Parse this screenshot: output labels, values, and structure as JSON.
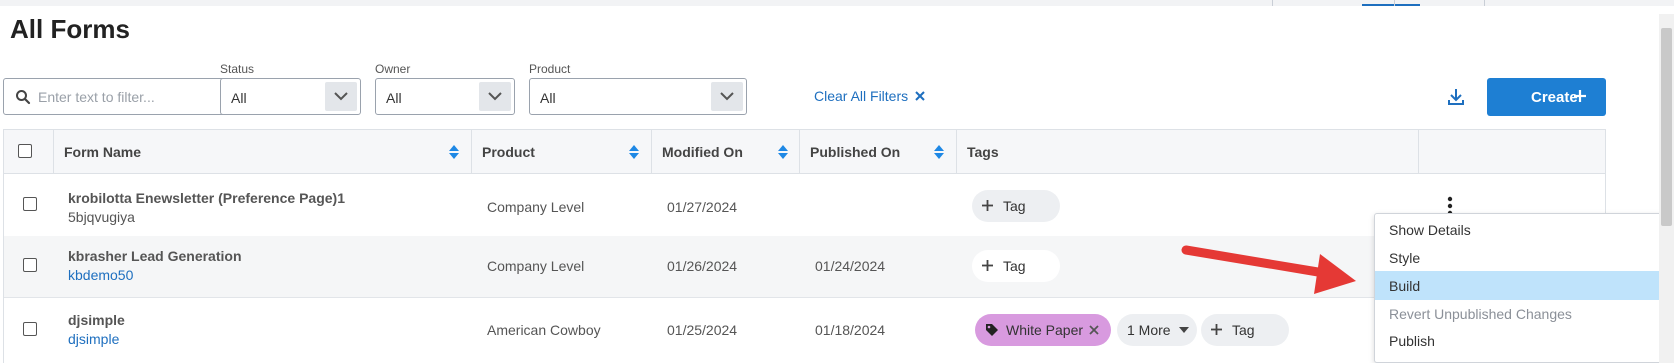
{
  "page": {
    "title": "All Forms"
  },
  "filters": {
    "search_placeholder": "Enter text to filter...",
    "status": {
      "label": "Status",
      "value": "All"
    },
    "owner": {
      "label": "Owner",
      "value": "All"
    },
    "product": {
      "label": "Product",
      "value": "All"
    },
    "clear_label": "Clear All Filters"
  },
  "toolbar": {
    "create_label": "Create"
  },
  "table": {
    "columns": [
      "Form Name",
      "Product",
      "Modified On",
      "Published On",
      "Tags"
    ],
    "rows": [
      {
        "name": "krobilotta Enewsletter (Preference Page)1",
        "sub": "5bjqvugiya",
        "product": "Company Level",
        "modified": "01/27/2024",
        "published": ""
      },
      {
        "name": "kbrasher Lead Generation",
        "sub": "kbdemo50",
        "product": "Company Level",
        "modified": "01/26/2024",
        "published": "01/24/2024"
      },
      {
        "name": "djsimple",
        "sub": "djsimple",
        "product": "American Cowboy",
        "modified": "01/25/2024",
        "published": "01/18/2024"
      }
    ],
    "tag_button_label": "Tag",
    "tag_white_paper": "White Paper",
    "more_label": "1 More"
  },
  "context_menu": {
    "items": [
      "Show Details",
      "Style",
      "Build",
      "Revert Unpublished Changes",
      "Publish"
    ],
    "active_item": "Build",
    "disabled_item": "Revert Unpublished Changes"
  },
  "colors": {
    "accent": "#1e7fd3",
    "link": "#1e6fbf",
    "tag_purple": "#d89adf",
    "menu_highlight": "#bfe3fb",
    "arrow": "#e53935"
  }
}
